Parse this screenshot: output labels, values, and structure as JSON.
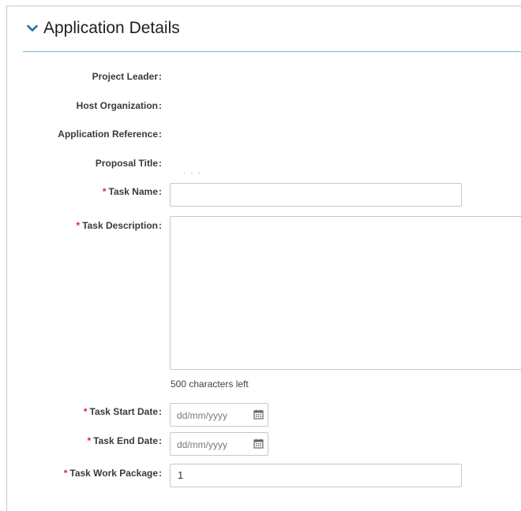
{
  "section": {
    "title": "Application Details",
    "icon": "chevron-down-icon",
    "accent_color": "#1a73a8",
    "divider_color": "#79b3cf"
  },
  "fields": {
    "project_leader": {
      "label": "Project Leader"
    },
    "host_organization": {
      "label": "Host Organization"
    },
    "application_reference": {
      "label": "Application Reference"
    },
    "proposal_title": {
      "label": "Proposal Title"
    },
    "task_name": {
      "label": "Task Name",
      "required": true,
      "value": ""
    },
    "task_description": {
      "label": "Task Description",
      "required": true,
      "value": ""
    },
    "characters_left": "500 characters left",
    "task_start_date": {
      "label": "Task Start Date",
      "required": true,
      "placeholder": "dd/mm/yyyy",
      "icon": "calendar-icon"
    },
    "task_end_date": {
      "label": "Task End Date",
      "required": true,
      "placeholder": "dd/mm/yyyy",
      "icon": "calendar-icon"
    },
    "task_work_package": {
      "label": "Task Work Package",
      "required": true,
      "value": "1"
    }
  },
  "required_marker": "*",
  "colon": ":",
  "required_color": "#d8262b"
}
